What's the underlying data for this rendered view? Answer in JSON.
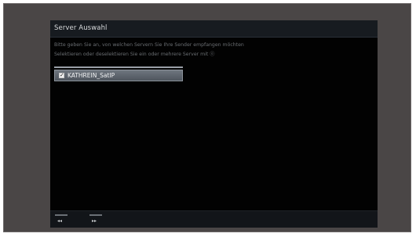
{
  "window": {
    "title": "Server Auswahl"
  },
  "instructions": {
    "line1": "Bitte geben Sie an, von welchen Servern Sie Ihre Sender empfangen möchten",
    "line2": "Selektieren oder deselektieren Sie ein oder mehrere Server mit ⓞ"
  },
  "server_list": {
    "items": [
      {
        "label": "KATHREIN_SatIP",
        "checked": true,
        "check_glyph": "✓"
      }
    ]
  },
  "footer": {
    "prev_icon": "◂◂",
    "next_icon": "▸▸"
  },
  "colors": {
    "title_bar": "#171b20",
    "screen_background": "#020202",
    "selected_item": "#5f666e",
    "bezel": "#4a4646"
  }
}
